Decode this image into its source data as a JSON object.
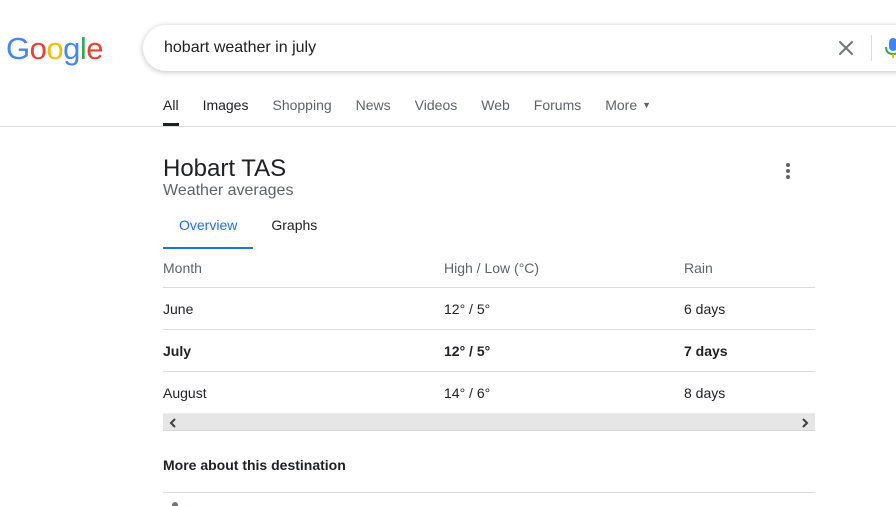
{
  "logo": {
    "letters": [
      "G",
      "o",
      "o",
      "g",
      "l",
      "e"
    ],
    "colors": [
      "#4285f4",
      "#ea4335",
      "#fbbc05",
      "#4285f4",
      "#34a853",
      "#ea4335"
    ]
  },
  "search": {
    "query": "hobart weather in july",
    "clear_icon": "close-icon",
    "mic_icon": "microphone-icon"
  },
  "tabs": [
    {
      "label": "All",
      "active": true
    },
    {
      "label": "Images"
    },
    {
      "label": "Shopping"
    },
    {
      "label": "News"
    },
    {
      "label": "Videos"
    },
    {
      "label": "Web"
    },
    {
      "label": "Forums"
    },
    {
      "label": "More"
    }
  ],
  "weather": {
    "title": "Hobart TAS",
    "subtitle": "Weather averages",
    "menu_icon": "more-vertical-icon",
    "subtabs": [
      {
        "label": "Overview",
        "active": true
      },
      {
        "label": "Graphs"
      }
    ],
    "columns": [
      "Month",
      "High / Low (°C)",
      "Rain"
    ],
    "rows": [
      {
        "month": "June",
        "temps": "12° / 5°",
        "rain": "6 days",
        "highlight": false
      },
      {
        "month": "July",
        "temps": "12° / 5°",
        "rain": "7 days",
        "highlight": true
      },
      {
        "month": "August",
        "temps": "14° / 6°",
        "rain": "8 days",
        "highlight": false
      }
    ]
  },
  "more_about": "More about this destination",
  "colors": {
    "accent": "#1a73e8",
    "text": "#202124",
    "muted": "#5f6368",
    "divider": "#dadce0"
  }
}
